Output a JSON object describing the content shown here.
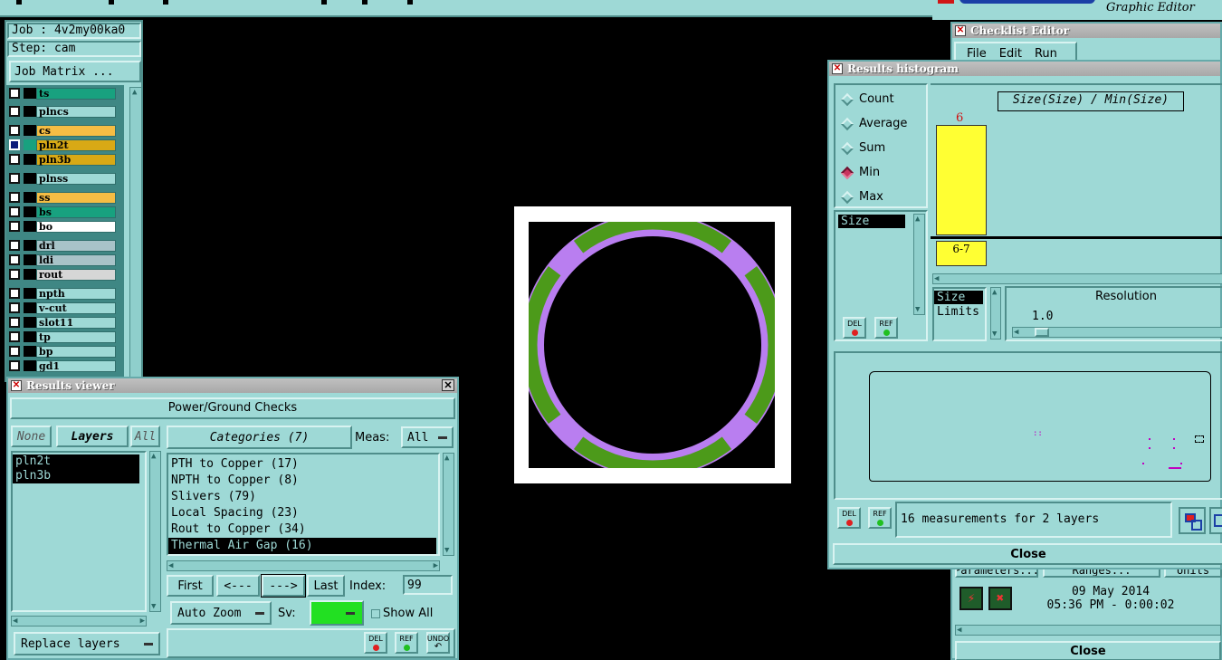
{
  "top": {
    "brand_text": "Graphic Editor"
  },
  "job_panel": {
    "job_label": "Job : 4v2my00ka0",
    "step_label": "Step: cam",
    "job_matrix_button": "Job Matrix ..."
  },
  "layers": [
    {
      "name": "ts",
      "color": "#18a17f",
      "marker": ""
    },
    {
      "name": "plncs",
      "color": "#9ed9d6",
      "marker": ""
    },
    {
      "name": "cs",
      "color": "#f5bd44",
      "marker": "⬋"
    },
    {
      "name": "pln2t",
      "color": "#d8a915",
      "marker": "⊞"
    },
    {
      "name": "pln3b",
      "color": "#d8a915",
      "marker": ""
    },
    {
      "name": "plnss",
      "color": "#9ed9d6",
      "marker": ""
    },
    {
      "name": "ss",
      "color": "#f5bd44",
      "marker": ""
    },
    {
      "name": "bs",
      "color": "#18a17f",
      "marker": ""
    },
    {
      "name": "bo",
      "color": "#ffffff",
      "marker": "⬋"
    },
    {
      "name": "drl",
      "color": "#a8c3c8",
      "marker": ""
    },
    {
      "name": "ldi",
      "color": "#a8c3c8",
      "marker": ""
    },
    {
      "name": "rout",
      "color": "#d6d6d6",
      "marker": ""
    },
    {
      "name": "npth",
      "color": "#9ed9d6",
      "marker": ""
    },
    {
      "name": "v-cut",
      "color": "#9ed9d6",
      "marker": ""
    },
    {
      "name": "slot11",
      "color": "#9ed9d6",
      "marker": ""
    },
    {
      "name": "tp",
      "color": "#9ed9d6",
      "marker": ""
    },
    {
      "name": "bp",
      "color": "#9ed9d6",
      "marker": ""
    },
    {
      "name": "gd1",
      "color": "#9ed9d6",
      "marker": "⬋"
    }
  ],
  "results_viewer": {
    "title": "Results viewer",
    "header": "Power/Ground Checks",
    "none_btn": "None",
    "layers_btn": "Layers",
    "all_btn": "All",
    "categories_btn": "Categories (7)",
    "meas_label": "Meas:",
    "meas_value": "All",
    "layer_list": [
      "pln2t",
      "pln3b"
    ],
    "categories": [
      "PTH to Copper (17)",
      "NPTH to Copper (8)",
      "Slivers (79)",
      "Local Spacing (23)",
      "Rout to Copper (34)",
      "Thermal Air Gap (16)"
    ],
    "selected_category": 5,
    "first_btn": "First",
    "prev_btn": "<---",
    "next_btn": "--->",
    "last_btn": "Last",
    "index_label": "Index:",
    "index_value": "99",
    "zoom_value": "Auto Zoom",
    "sv_label": "Sv:",
    "show_all_label": "Show All",
    "replace_layers": "Replace layers",
    "del_label": "DEL",
    "ref_label": "REF",
    "undo_label": "UNDO"
  },
  "checklist_editor": {
    "title": "Checklist Editor",
    "menu": [
      "File",
      "Edit",
      "Run"
    ],
    "tabs": [
      "Parameters...",
      "Ranges...",
      "Units"
    ],
    "date": "09 May 2014",
    "time": "05:36 PM - 0:00:02",
    "close": "Close"
  },
  "histogram": {
    "title": "Results histogram",
    "modes": [
      "Count",
      "Average",
      "Sum",
      "Min",
      "Max"
    ],
    "selected_mode": "Min",
    "field_list": [
      "Size"
    ],
    "chart_title": "Size(Size) / Min(Size)",
    "bar_value": "6",
    "bar_range": "6-7",
    "bar_fraction": 1.0,
    "bar_color": "#ffff33",
    "size_list": [
      "Size",
      "Limits"
    ],
    "resolution_label": "Resolution",
    "resolution_value": "1.0",
    "status": "16 measurements for 2 layers",
    "close": "Close",
    "del_label": "DEL",
    "ref_label": "REF"
  }
}
